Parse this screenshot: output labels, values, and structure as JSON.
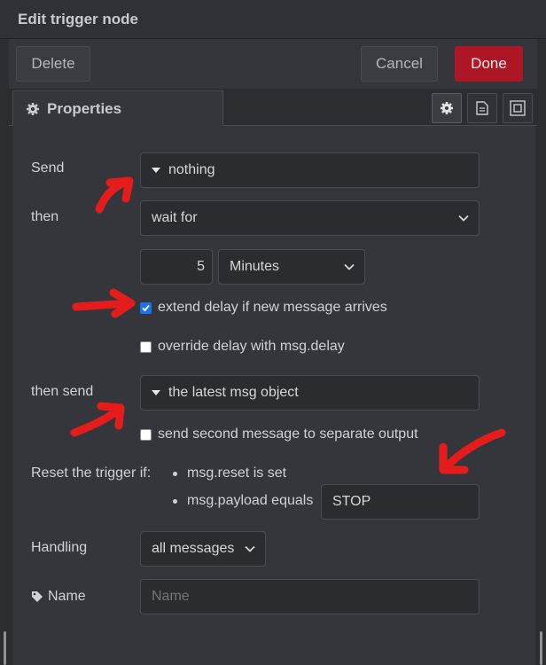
{
  "title": "Edit trigger node",
  "toolbar": {
    "delete": "Delete",
    "cancel": "Cancel",
    "done": "Done"
  },
  "tabs": {
    "properties": "Properties"
  },
  "form": {
    "send_label": "Send",
    "send_value": "nothing",
    "then_label": "then",
    "then_value": "wait for",
    "delay_value": "5",
    "delay_unit": "Minutes",
    "extend_delay": "extend delay if new message arrives",
    "override_delay": "override delay with msg.delay",
    "then_send_label": "then send",
    "then_send_value": "the latest msg object",
    "second_output": "send second message to separate output",
    "reset_label": "Reset the trigger if:",
    "reset_msg": "msg.reset is set",
    "reset_payload": "msg.payload equals",
    "reset_payload_value": "STOP",
    "handling_label": "Handling",
    "handling_value": "all messages",
    "name_label": "Name",
    "name_placeholder": "Name"
  },
  "checkboxes": {
    "extend_delay_checked": true,
    "override_delay_checked": false,
    "second_output_checked": false
  },
  "colors": {
    "accent": "#ad1625",
    "arrow": "#e51c1c",
    "checkbox": "#1a73e8"
  },
  "icons": [
    "gear-icon",
    "document-icon",
    "frame-icon",
    "chevron-down-icon",
    "caret-down-icon",
    "tag-icon"
  ]
}
